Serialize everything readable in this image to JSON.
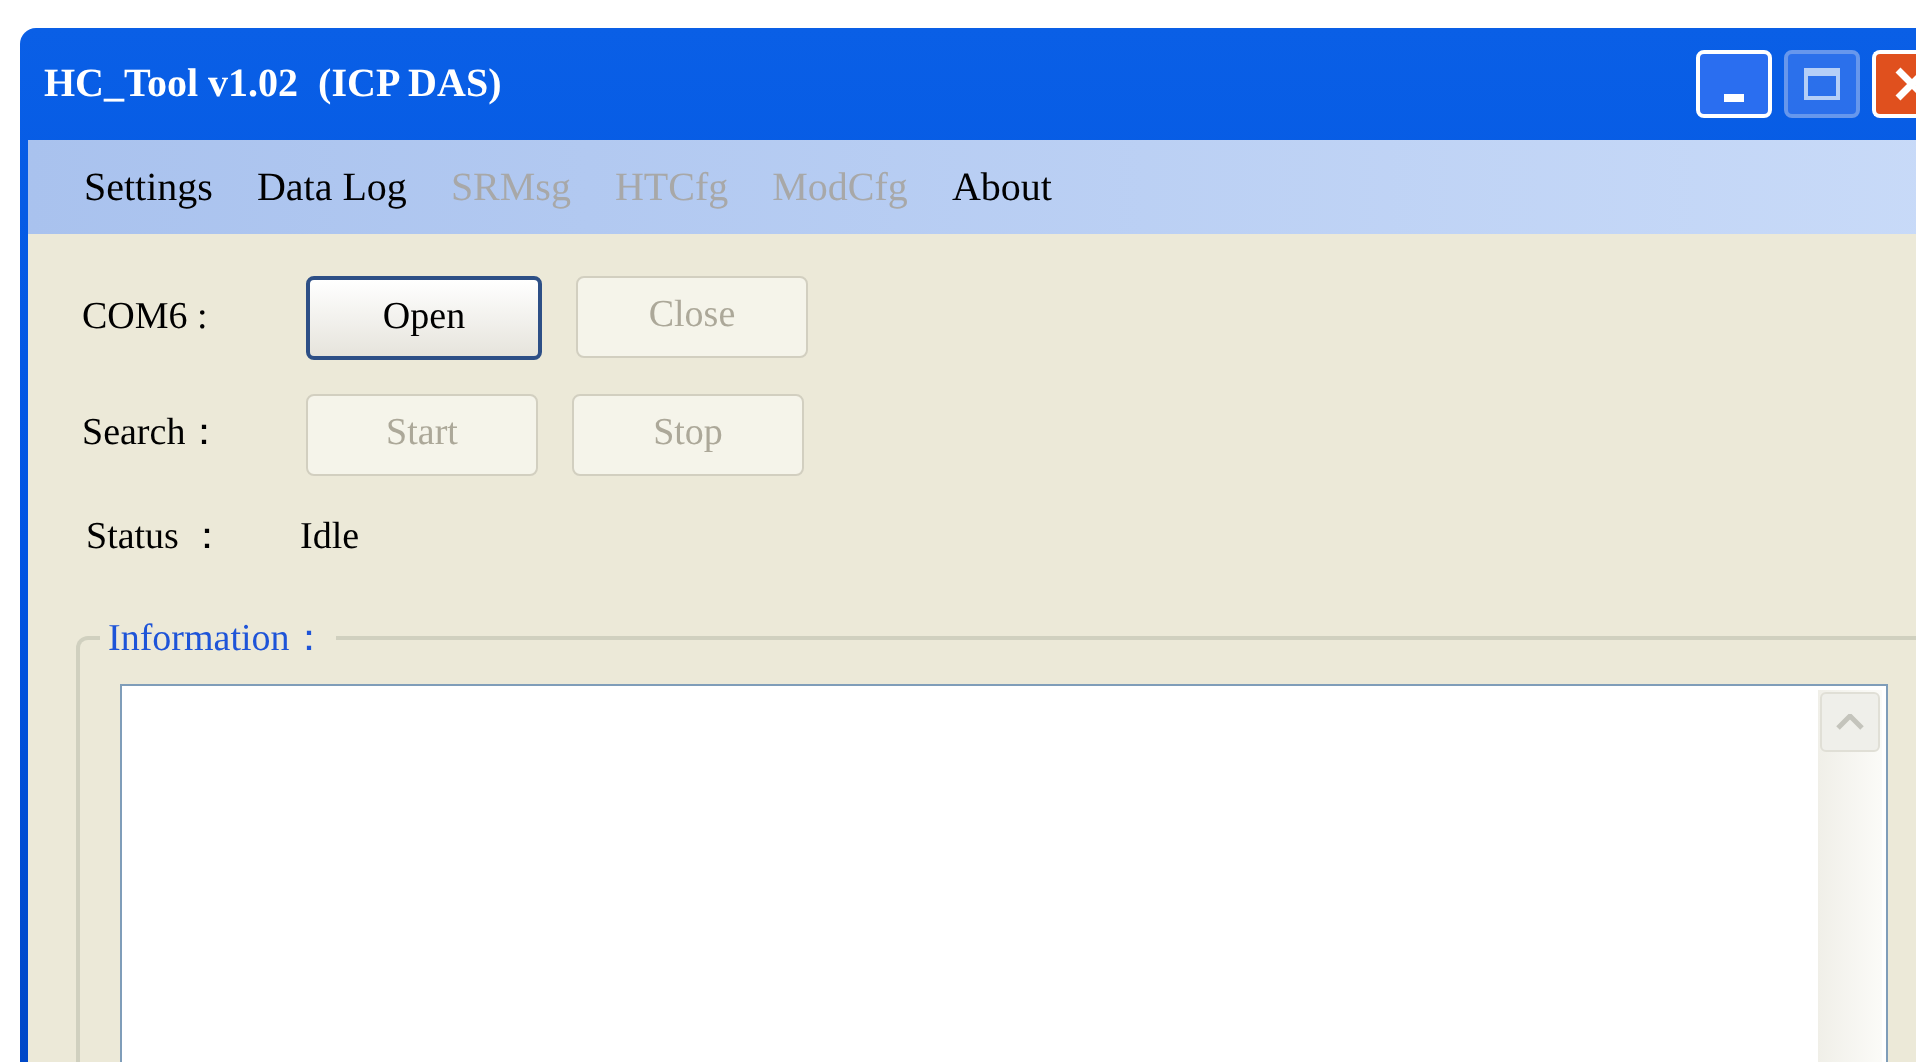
{
  "window": {
    "title": "HC_Tool v1.02  (ICP DAS)"
  },
  "menu": [
    {
      "label": "Settings",
      "disabled": false
    },
    {
      "label": "Data Log",
      "disabled": false
    },
    {
      "label": "SRMsg",
      "disabled": true
    },
    {
      "label": "HTCfg",
      "disabled": true
    },
    {
      "label": "ModCfg",
      "disabled": true
    },
    {
      "label": "About",
      "disabled": false
    }
  ],
  "rows": [
    {
      "kind": "buttons",
      "label": "COM6 :",
      "buttons": [
        {
          "label": "Open",
          "disabled": false
        },
        {
          "label": "Close",
          "disabled": true
        }
      ]
    },
    {
      "kind": "buttons",
      "label": "Search：",
      "buttons": [
        {
          "label": "Start",
          "disabled": true
        },
        {
          "label": "Stop",
          "disabled": true
        }
      ]
    },
    {
      "kind": "status",
      "label": "Status ：",
      "value": "Idle"
    }
  ],
  "information": {
    "label": "Information："
  }
}
